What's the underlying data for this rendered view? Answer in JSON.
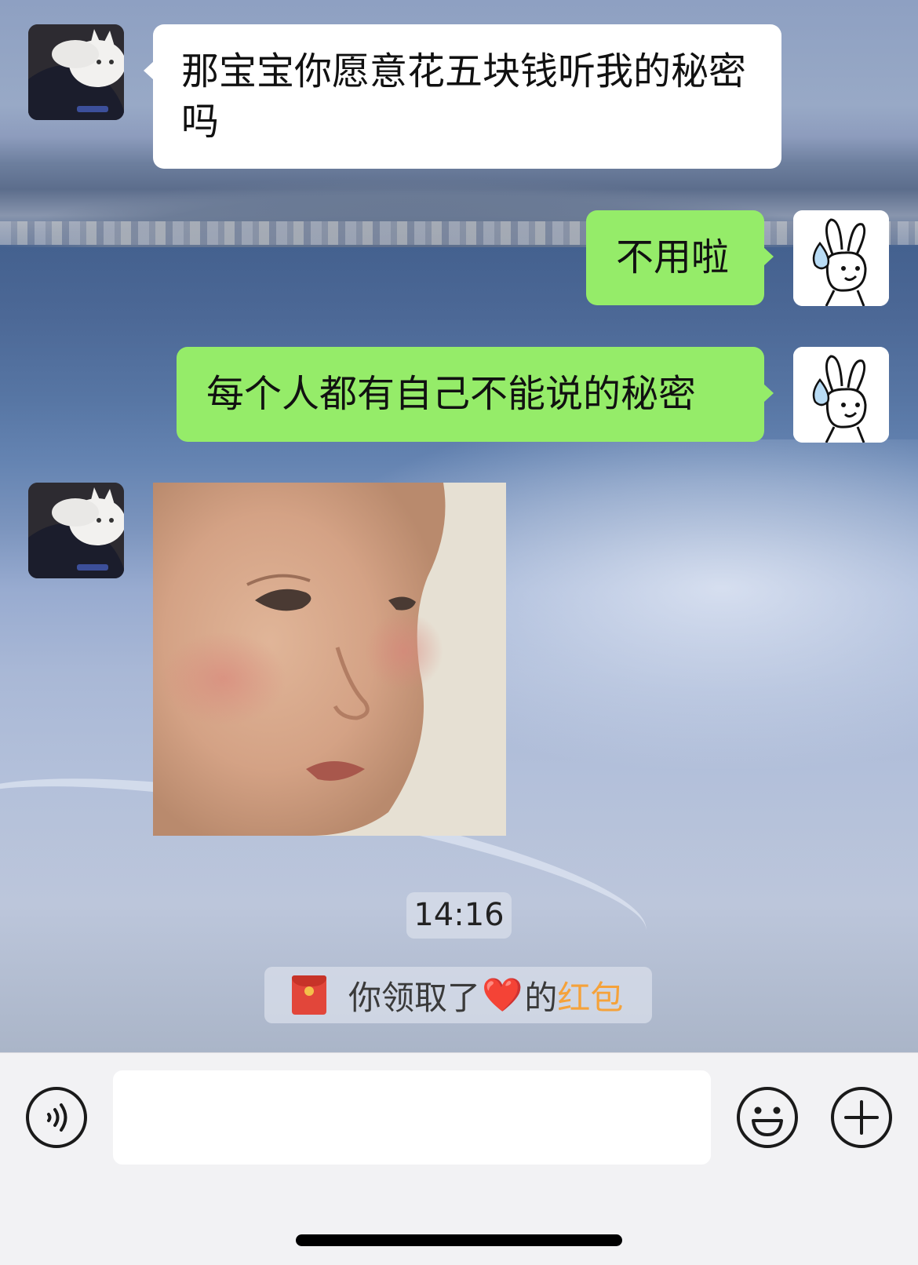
{
  "conversation": {
    "messages": [
      {
        "sender": "contact",
        "type": "text",
        "text": "那宝宝你愿意花五块钱听我的秘密吗"
      },
      {
        "sender": "me",
        "type": "text",
        "text": "不用啦"
      },
      {
        "sender": "me",
        "type": "text",
        "text": "每个人都有自己不能说的秘密"
      },
      {
        "sender": "contact",
        "type": "sticker",
        "sticker": "baby-face-sticker"
      }
    ],
    "timestamp": "14:16",
    "system_notice": {
      "icon": "red-packet-icon",
      "prefix": "你领取了",
      "heart": "❤️",
      "middle": "的",
      "link_text": "红包"
    }
  },
  "input_bar": {
    "voice_icon": "voice-mode-icon",
    "input_value": "",
    "emoji_icon": "emoji-icon",
    "more_icon": "plus-circle-icon"
  },
  "colors": {
    "outgoing_bubble": "#95ec69",
    "incoming_bubble": "#ffffff",
    "red_packet_link": "#f5a23a"
  }
}
